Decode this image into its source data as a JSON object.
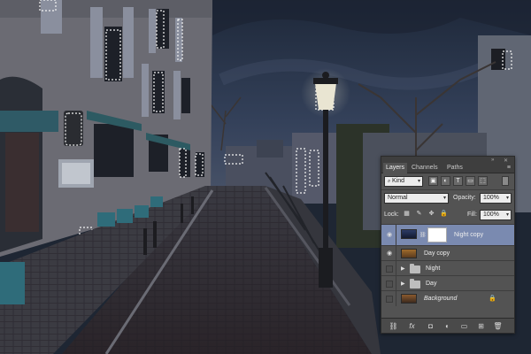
{
  "panel": {
    "tabs": [
      "Layers",
      "Channels",
      "Paths"
    ],
    "filter_kind": "Kind",
    "blend_mode": "Normal",
    "opacity_label": "Opacity:",
    "opacity_value": "100%",
    "lock_label": "Lock:",
    "fill_label": "Fill:",
    "fill_value": "100%",
    "layers": [
      {
        "name": "Night copy",
        "visible": true,
        "selected": true,
        "type": "layer-mask"
      },
      {
        "name": "Day copy",
        "visible": true,
        "selected": false,
        "type": "layer"
      },
      {
        "name": "Night",
        "visible": false,
        "selected": false,
        "type": "group"
      },
      {
        "name": "Day",
        "visible": false,
        "selected": false,
        "type": "group"
      },
      {
        "name": "Background",
        "visible": false,
        "selected": false,
        "type": "background",
        "locked": true
      }
    ]
  },
  "icons": {
    "filter_icons": [
      "image-filter-icon",
      "adjustment-filter-icon",
      "type-filter-icon",
      "shape-filter-icon",
      "smart-object-filter-icon"
    ],
    "lock_icons": [
      "lock-transparent-icon",
      "lock-image-icon",
      "lock-position-icon",
      "lock-all-icon"
    ],
    "bottom_icons": [
      "link-layers-icon",
      "fx-icon",
      "add-mask-icon",
      "adjustment-layer-icon",
      "new-group-icon",
      "new-layer-icon",
      "delete-icon"
    ]
  },
  "colors": {
    "panel_bg": "#535353",
    "selected_row": "#7a8ab0",
    "sky": "#2a3446",
    "street": "#2f3036"
  }
}
